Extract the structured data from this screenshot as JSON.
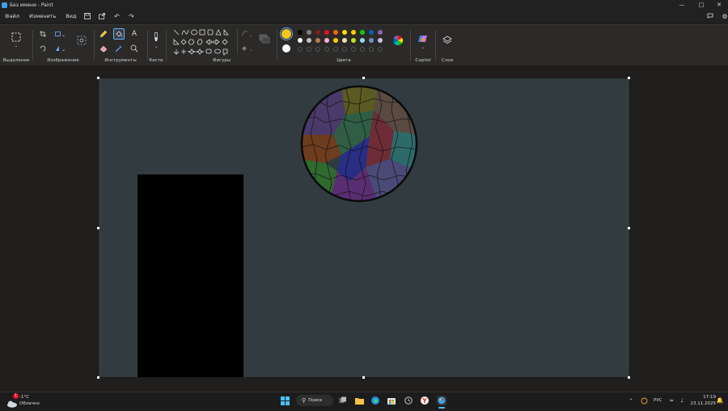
{
  "window": {
    "title": "Без имени - Paint",
    "controls": [
      "minimize",
      "maximize",
      "close"
    ]
  },
  "menu": {
    "items": [
      "Файл",
      "Изменить",
      "Вид"
    ]
  },
  "ribbon": {
    "groups": {
      "selection": "Выделение",
      "image": "Изображение",
      "tools": "Инструменты",
      "brushes": "Кисти",
      "shapes": "Фигуры",
      "colors": "Цвета",
      "copilot": "Copilot",
      "layers": "Слои"
    },
    "active_tool": "fill",
    "primary_color": "#f5c518",
    "secondary_color": "#ffffff",
    "palette_row1": [
      "#000000",
      "#7f7f7f",
      "#8b1a1a",
      "#e81123",
      "#f7630c",
      "#fce100",
      "#ffcd00",
      "#16c60c",
      "#0063b1",
      "#8764b8"
    ],
    "palette_row2": [
      "#ffffff",
      "#c3c3c3",
      "#b97a57",
      "#ffaec9",
      "#ffc90e",
      "#efe4b0",
      "#b5e61d",
      "#99d9ea",
      "#7092be",
      "#c8bfe7"
    ]
  },
  "taskbar": {
    "weather_temp": "-1°C",
    "weather_desc": "Облачно",
    "weather_badge": "1",
    "search_label": "Поиск",
    "language": "РУС",
    "time": "17:19",
    "date": "23.11.2025"
  }
}
